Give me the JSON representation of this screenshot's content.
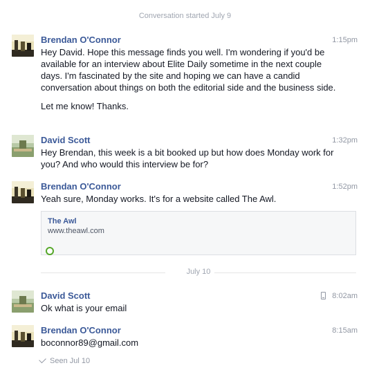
{
  "conversation": {
    "started_label": "Conversation started July 9"
  },
  "messages": [
    {
      "sender": "Brendan O'Connor",
      "time": "1:15pm",
      "paragraphs": [
        "Hey David. Hope this message finds you well. I'm wondering if you'd be available for an interview about Elite Daily sometime in the next couple days. I'm fascinated by the site and hoping we can have a candid conversation about things on both the editorial side and the business side.",
        "Let me know! Thanks."
      ]
    },
    {
      "sender": "David Scott",
      "time": "1:32pm",
      "paragraphs": [
        "Hey Brendan, this week is a bit booked up but how does Monday work for you? And who would this interview be for?"
      ]
    },
    {
      "sender": "Brendan O'Connor",
      "time": "1:52pm",
      "paragraphs": [
        "Yeah sure, Monday works. It's for a website called The Awl."
      ],
      "link_card": {
        "title": "The Awl",
        "url": "www.theawl.com",
        "favicon": "green-ring-icon"
      }
    },
    {
      "sender": "David Scott",
      "time": "8:02am",
      "device_icon": "mobile-phone-icon",
      "paragraphs": [
        "Ok what is your email"
      ]
    },
    {
      "sender": "Brendan O'Connor",
      "time": "8:15am",
      "paragraphs": [
        "boconnor89@gmail.com"
      ]
    }
  ],
  "date_divider": "July 10",
  "seen_label": "Seen Jul 10",
  "colors": {
    "sender_name": "#3b5998",
    "timestamp": "#9197a3",
    "favicon": "#56a82a"
  }
}
